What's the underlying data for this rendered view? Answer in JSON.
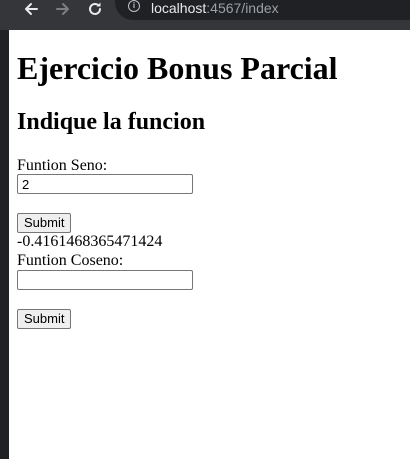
{
  "browser": {
    "url_host": "localhost",
    "url_path": ":4567/index",
    "toolbar_color": "#35363a",
    "omnibox_color": "#202124"
  },
  "page": {
    "title": "Ejercicio Bonus Parcial",
    "subtitle": "Indique la funcion",
    "seno": {
      "label": "Funtion Seno:",
      "value": "2",
      "submit_label": "Submit",
      "result": "-0.4161468365471424"
    },
    "coseno": {
      "label": "Funtion Coseno:",
      "value": "",
      "submit_label": "Submit"
    }
  }
}
